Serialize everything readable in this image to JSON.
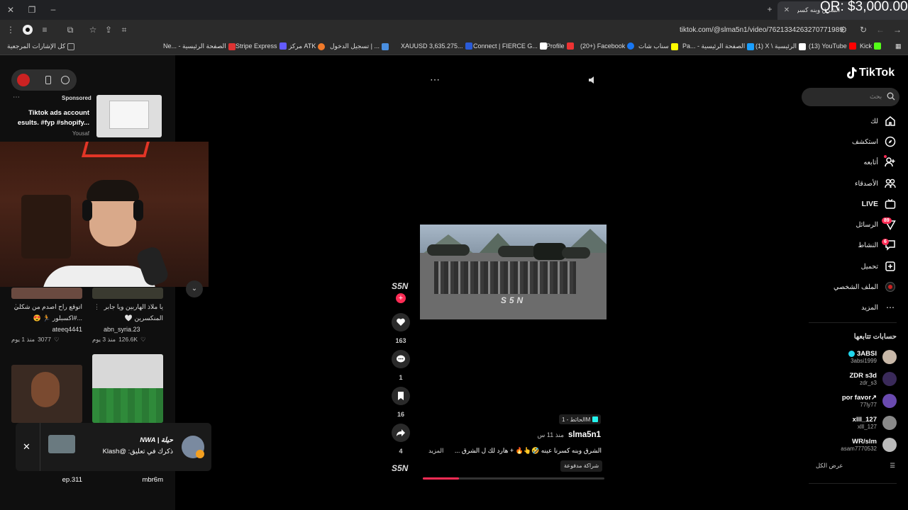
{
  "browser": {
    "tab_title": "الشرق وبنه كسرنا عينه",
    "qr_overlay": "QR: $3,000.00",
    "url": "tiktok.com/@slma5n1/video/7621334263270771989"
  },
  "bookmarks": [
    {
      "label": "كل الإشارات المرجعية",
      "color": "#666"
    },
    {
      "label": "Ne... - الصفحة الرئيسية",
      "color": "#d33"
    },
    {
      "label": "Stripe Express",
      "color": "#635bff"
    },
    {
      "label": "مركز ATK",
      "color": "#f07a2a"
    },
    {
      "label": "تسجيل الدخول | ...",
      "color": "#4a8fe0"
    },
    {
      "label": "XAUUSD 3,635.275...",
      "color": "#2a5bd7"
    },
    {
      "label": "Connect | FIERCE G...",
      "color": "#fff"
    },
    {
      "label": "Profile",
      "color": "#e33"
    },
    {
      "label": "(20+) Facebook",
      "color": "#1877f2"
    },
    {
      "label": "سناب شات",
      "color": "#fffc00"
    },
    {
      "label": "Pa... - الصفحة الرئيسية",
      "color": "#1a9fff"
    },
    {
      "label": "(1) X \\ الرئيسية",
      "color": "#fff"
    },
    {
      "label": "(13) YouTube",
      "color": "#f00"
    },
    {
      "label": "Kick",
      "color": "#53fc18"
    }
  ],
  "left_panel": {
    "sponsored_label": "Sponsored",
    "ad_title_1": "Tiktok ads account",
    "ad_title_2": "esults. #fyp #shopify...",
    "ad_author": "Yousaf",
    "cards": [
      {
        "title_1": "يا ملاذ الهاربين ويا جابر",
        "title_2": "المنكسرين 🤍",
        "user": "abn_syria.23",
        "likes": "126.6K",
        "ago": "منذ 3 يوم"
      },
      {
        "title_1": "اتوقع راح اصدم من شكلي",
        "title_2": "...#اكسبلور 🏃 😍",
        "user": "ateeq4441",
        "likes": "3077",
        "ago": "منذ 1 يوم"
      }
    ],
    "bottom_users": [
      "mbr6m",
      "ep.311"
    ],
    "notif_title": "NWA | حيلة",
    "notif_body": "ذكرك في تعليق: @Klash"
  },
  "video": {
    "watermark": "S5N",
    "likes": "163",
    "comments": "1",
    "saves": "16",
    "shares": "4",
    "author": "slma5n1",
    "time_ago": "منذ 11 س",
    "sound_tag": "الحائط - 1M",
    "caption": "الشرق وبنه كسرنا عينه 🤣👆🔥 + هارد لك ل الشرق ...",
    "more_label": "المزيد",
    "paid_label": "شراكة مدفوعة",
    "progress": 0.2
  },
  "tiktok": {
    "logo": "TikTok",
    "search_placeholder": "بحث",
    "nav": [
      {
        "label": "لك",
        "icon": "home-icon"
      },
      {
        "label": "استكشف",
        "icon": "compass-icon"
      },
      {
        "label": "أتابعه",
        "icon": "user-follow-icon"
      },
      {
        "label": "الأصدقاء",
        "icon": "friends-icon"
      },
      {
        "label": "LIVE",
        "icon": "live-icon"
      },
      {
        "label": "الرسائل",
        "icon": "messages-icon",
        "badge": "89"
      },
      {
        "label": "النشاط",
        "icon": "activity-icon",
        "badge": "6"
      },
      {
        "label": "تحميل",
        "icon": "upload-icon"
      },
      {
        "label": "الملف الشخصي",
        "icon": "profile-icon"
      },
      {
        "label": "المزيد",
        "icon": "more-icon"
      }
    ],
    "following_title": "حسابات تتابعها",
    "following": [
      {
        "name": "3ABSI",
        "user": "3absi1999"
      },
      {
        "name": "ZDR s3d",
        "user": "zdr_s3"
      },
      {
        "name": "por favor↗",
        "user": "77ly77"
      },
      {
        "name": "xlll_127",
        "user": "xlll_127"
      },
      {
        "name": "WR/slm",
        "user": "asam7770532"
      }
    ],
    "show_all": "عرض الكل"
  }
}
